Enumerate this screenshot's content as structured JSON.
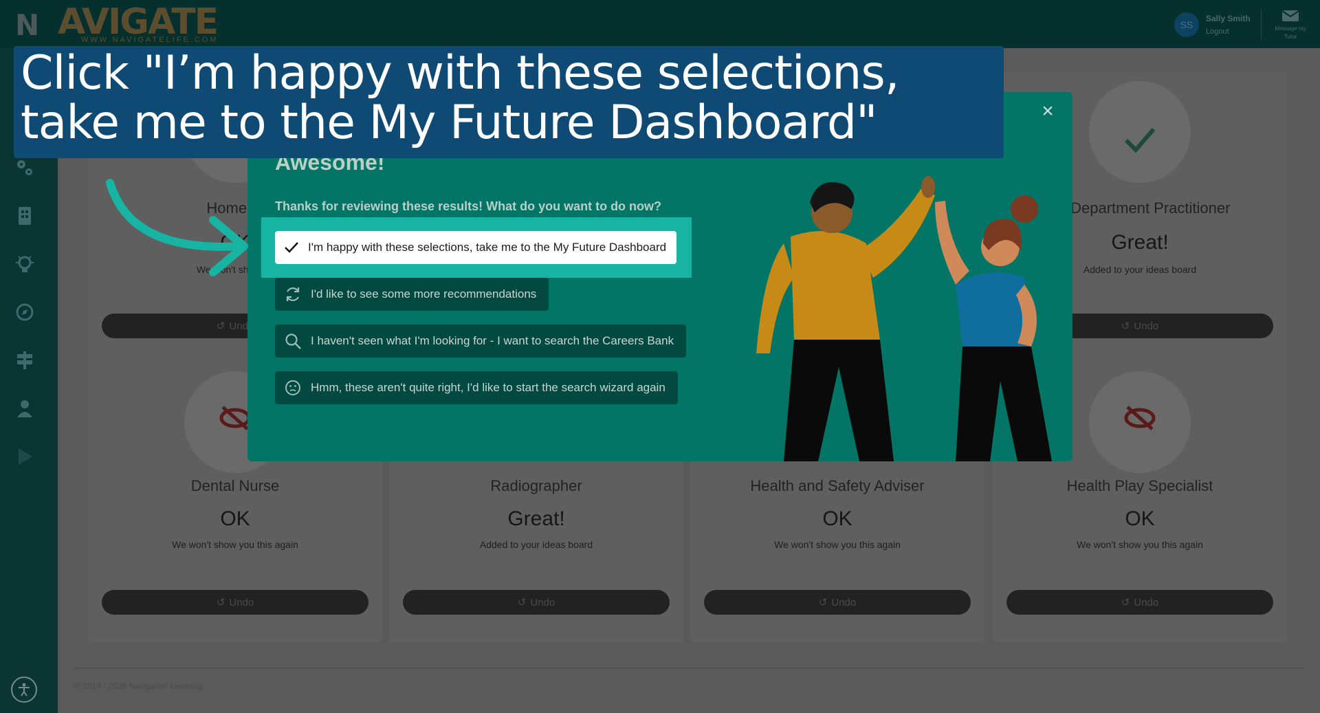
{
  "header": {
    "logo_letter": "N",
    "logo_word": "AVIGATE",
    "logo_url": "WWW.NAVIGATELIFE.COM",
    "user_initials": "SS",
    "user_name": "Sally Smith",
    "logout": "Logout",
    "message_label": "Message my Tutor"
  },
  "sidebar": {
    "icons": [
      "gears-icon",
      "building-icon",
      "lightbulb-icon",
      "compass-icon",
      "signpost-icon",
      "person-icon",
      "play-icon"
    ],
    "accessibility": "accessibility-icon"
  },
  "cards": [
    {
      "title": "Homeop",
      "status": "OK",
      "note": "We won't show yo",
      "undo": "Undo"
    },
    {
      "title": "ng Department Practitioner",
      "status": "Great!",
      "note": "Added to your ideas board",
      "undo": "Undo"
    },
    {
      "title": "Dental Nurse",
      "status": "OK",
      "note": "We won't show you this again",
      "undo": "Undo"
    },
    {
      "title": "Radiographer",
      "status": "Great!",
      "note": "Added to your ideas board",
      "undo": "Undo"
    },
    {
      "title": "Health and Safety Adviser",
      "status": "OK",
      "note": "We won't show you this again",
      "undo": "Undo"
    },
    {
      "title": "Health Play Specialist",
      "status": "OK",
      "note": "We won't show you this again",
      "undo": "Undo"
    }
  ],
  "footer": {
    "copyright": "© 2014 - 2026 Navigation Learning"
  },
  "modal": {
    "close": "×",
    "heading": "Awesome!",
    "question": "Thanks for reviewing these results! What do you want to do now?",
    "options": [
      {
        "label": "I'm happy with these selections, take me to the My Future Dashboard",
        "icon": "checkmark-icon"
      },
      {
        "label": "I'd like to see some more recommendations",
        "icon": "refresh-icon"
      },
      {
        "label": "I haven't seen what I'm looking for - I want to search the Careers Bank",
        "icon": "search-icon"
      },
      {
        "label": "Hmm, these aren't quite right, I'd like to start the search wizard again",
        "icon": "thinking-face-icon"
      }
    ]
  },
  "banner": {
    "text": "Click \"I’m happy with these selections, take me to the My Future Dashboard\""
  },
  "colors": {
    "modal_bg": "#037566",
    "highlight": "#17b3a3",
    "banner_bg": "#0e4a73"
  }
}
